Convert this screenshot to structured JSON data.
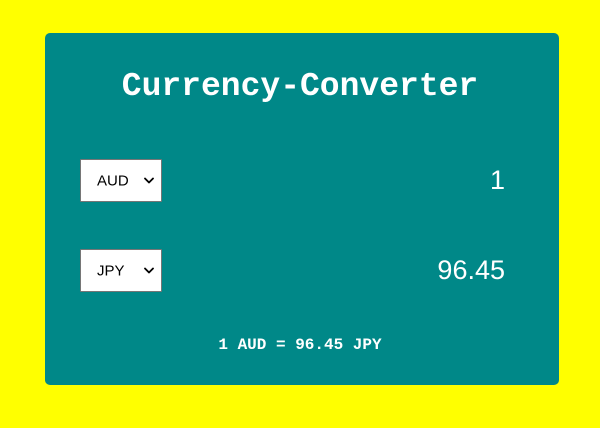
{
  "app": {
    "title": "Currency-Converter"
  },
  "from": {
    "currency": "AUD",
    "amount": "1"
  },
  "to": {
    "currency": "JPY",
    "amount": "96.45"
  },
  "rate_text": "1 AUD = 96.45 JPY",
  "colors": {
    "page_background": "#ffff00",
    "card_background": "#008888",
    "text": "#ffffff"
  },
  "icons": {
    "dropdown": "chevron-down-icon"
  }
}
